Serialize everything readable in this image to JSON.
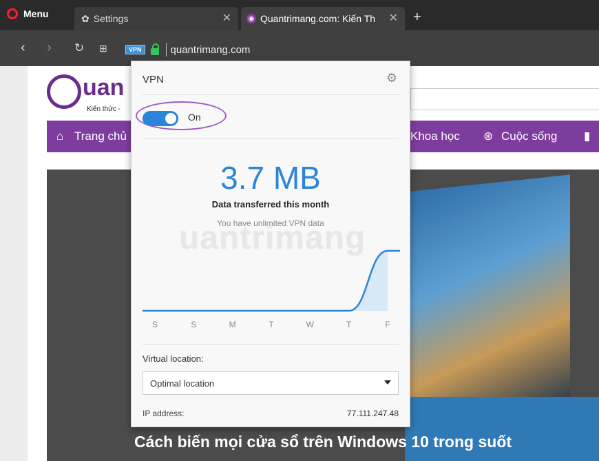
{
  "browser": {
    "menu_label": "Menu",
    "tabs": [
      {
        "title": "Settings"
      },
      {
        "title": "Quantrimang.com: Kiến Th"
      }
    ],
    "url": "quantrimang.com",
    "vpn_badge": "VPN"
  },
  "site": {
    "logo_text": "uan",
    "logo_sub": "Kiến thức -",
    "nav": [
      "Trang chủ",
      "Khoa học",
      "Cuộc sống"
    ],
    "headline": "Cách biến mọi cửa sổ trên Windows 10 trong suốt",
    "watermark": "uantrimang"
  },
  "vpn_popup": {
    "title": "VPN",
    "toggle_label": "On",
    "toggle_state": "on",
    "data_amount": "3.7 MB",
    "data_caption": "Data transferred this month",
    "data_note": "You have unlimited VPN data",
    "location_label": "Virtual location:",
    "location_value": "Optimal location",
    "ip_label": "IP address:",
    "ip_value": "77.111.247.48"
  },
  "chart_data": {
    "type": "area",
    "categories": [
      "S",
      "S",
      "M",
      "T",
      "W",
      "T",
      "F"
    ],
    "values": [
      0,
      0,
      0,
      0,
      0,
      0,
      3.7
    ],
    "ylim": [
      0,
      4
    ]
  },
  "colors": {
    "accent": "#2a84d8",
    "brand": "#7e3d9e",
    "highlight_ring": "#a05cc8"
  }
}
